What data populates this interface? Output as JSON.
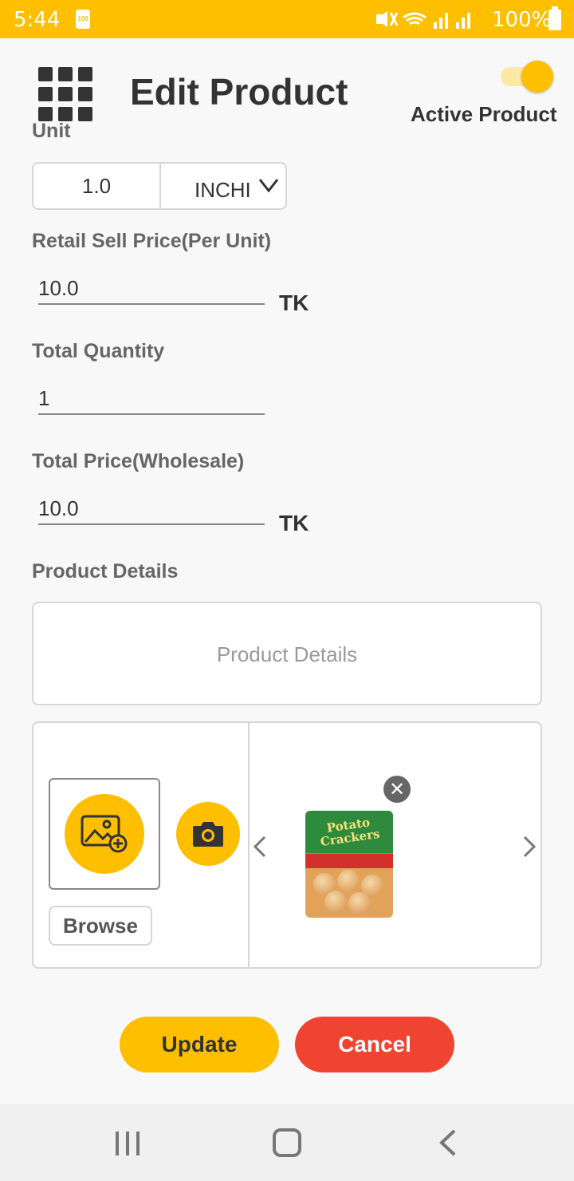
{
  "status_bar": {
    "time": "5:44",
    "battery_small": "100",
    "battery_pct": "100%"
  },
  "header": {
    "title": "Edit Product",
    "active_label": "Active Product",
    "active_on": true
  },
  "form": {
    "unit": {
      "label": "Unit",
      "value": "1.0",
      "selected": "INCHI"
    },
    "retail": {
      "label": "Retail Sell Price(Per Unit)",
      "value": "10.0",
      "currency": "TK"
    },
    "quantity": {
      "label": "Total Quantity",
      "value": "1"
    },
    "wholesale": {
      "label": "Total Price(Wholesale)",
      "value": "10.0",
      "currency": "TK"
    },
    "details": {
      "label": "Product Details",
      "placeholder": "Product Details"
    }
  },
  "image_panel": {
    "browse_label": "Browse",
    "product_image_text": "Potato Crackers"
  },
  "actions": {
    "update": "Update",
    "cancel": "Cancel"
  },
  "icons": [
    "grid-menu-icon",
    "image-add-icon",
    "camera-icon",
    "close-icon",
    "chevron-left-icon",
    "chevron-right-icon",
    "chevron-down-icon"
  ],
  "colors": {
    "accent": "#fdbf00",
    "danger": "#f04433"
  }
}
